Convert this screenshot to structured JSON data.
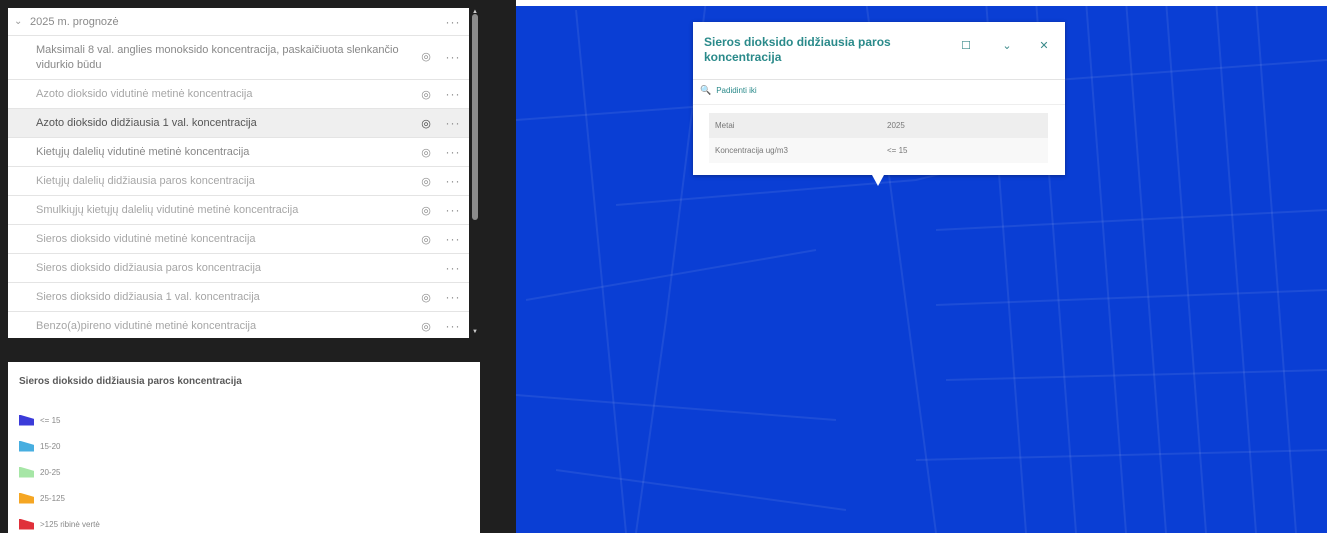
{
  "layers": {
    "group_label": "2025 m. prognozė",
    "items": [
      {
        "label": "Maksimali 8 val. anglies monoksido koncentracija, paskaičiuota slenkančio vidurkio būdu",
        "style": "tall",
        "eye": true
      },
      {
        "label": "Azoto dioksido vidutinė metinė koncentracija",
        "style": "faint",
        "eye": true
      },
      {
        "label": "Azoto dioksido didžiausia 1 val. koncentracija",
        "style": "active",
        "eye": true
      },
      {
        "label": "Kietųjų dalelių vidutinė metinė koncentracija",
        "style": "",
        "eye": true
      },
      {
        "label": "Kietųjų dalelių didžiausia paros koncentracija",
        "style": "faint",
        "eye": true
      },
      {
        "label": "Smulkiųjų kietųjų dalelių vidutinė metinė koncentracija",
        "style": "faint",
        "eye": true
      },
      {
        "label": "Sieros dioksido vidutinė metinė koncentracija",
        "style": "faint",
        "eye": true
      },
      {
        "label": "Sieros dioksido didžiausia paros koncentracija",
        "style": "faint",
        "eye": false
      },
      {
        "label": "Sieros dioksido didžiausia 1 val. koncentracija",
        "style": "faint",
        "eye": true
      },
      {
        "label": "Benzo(a)pireno vidutinė metinė koncentracija",
        "style": "faint",
        "eye": true
      }
    ]
  },
  "legend": {
    "title": "Sieros dioksido didžiausia paros koncentracija",
    "items": [
      {
        "label": "<= 15",
        "color": "#3b3bd9"
      },
      {
        "label": "15-20",
        "color": "#47aee0"
      },
      {
        "label": "20-25",
        "color": "#a6e6a6"
      },
      {
        "label": "25-125",
        "color": "#f5a623"
      },
      {
        "label": ">125 ribinė vertė",
        "color": "#e0303a"
      }
    ]
  },
  "popup": {
    "title": "Sieros dioksido didžiausia paros koncentracija",
    "zoom_label": "Padidinti iki",
    "rows": [
      {
        "key": "Metai",
        "value": "2025"
      },
      {
        "key": "Koncentracija ug/m3",
        "value": "<= 15"
      }
    ]
  },
  "colors": {
    "map_background": "#0a3ed4",
    "accent": "#2a8a8a",
    "panel_dark": "#1f1f1f"
  }
}
